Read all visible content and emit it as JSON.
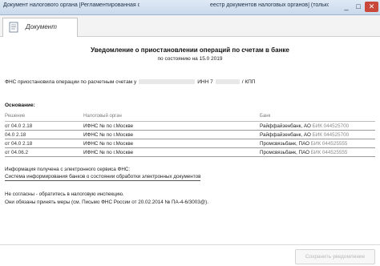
{
  "window": {
    "title_left": "Документ налогового органа [Регламентированная отчетность",
    "title_right": "еестр документов налоговых органов] (только чтение)",
    "minimize": "_",
    "maximize": "□",
    "close": "✕"
  },
  "tab": {
    "label": "Документ",
    "icon": "document-icon"
  },
  "document": {
    "title": "Уведомление о приостановлении операций по счетам в банке",
    "date_line": "по состоянию на 15.0 2019",
    "intro": "ФНС приостановила операции по расчетным счетам у",
    "intro_inn": "ИНН 7",
    "intro_kpp": "/ КПП",
    "basis_label": "Основание:",
    "columns": [
      "Решение",
      "Налоговый орган",
      "Банк"
    ],
    "rows": [
      {
        "decision": "от 04.0 2.18",
        "tax": "ИФНС № по г.Москве",
        "bank": "Райффайзенбанк, АО",
        "bik": "БИК 044525700"
      },
      {
        "decision": "04.0 2.18",
        "tax": "ИФНС № по г.Москве",
        "bank": "Райффайзенбанк, АО",
        "bik": "БИК 044525700"
      },
      {
        "decision": "от 04.0 2.18",
        "tax": "ИФНС № по г.Москве",
        "bank": "Промсвязьбанк, ПАО",
        "bik": "БИК 044525555"
      },
      {
        "decision": "от 04.06.2",
        "tax": "ИФНС № по г.Москве",
        "bank": "Промсвязьбанк, ПАО",
        "bik": "БИК 044525555"
      }
    ],
    "info_line1": "Информация получена с электронного сервиса ФНС:",
    "info_line2": "Система информирования банков о состоянии обработки электронных документов",
    "note1": "Не согласны - обратитесь в налоговую инспекцию.",
    "note2": "Они обязаны принять меры (см. Письмо ФНС России от 20.02.2014 № ПА-4-6/3003@)."
  },
  "footer": {
    "save_label": "Сохранить уведомление"
  }
}
